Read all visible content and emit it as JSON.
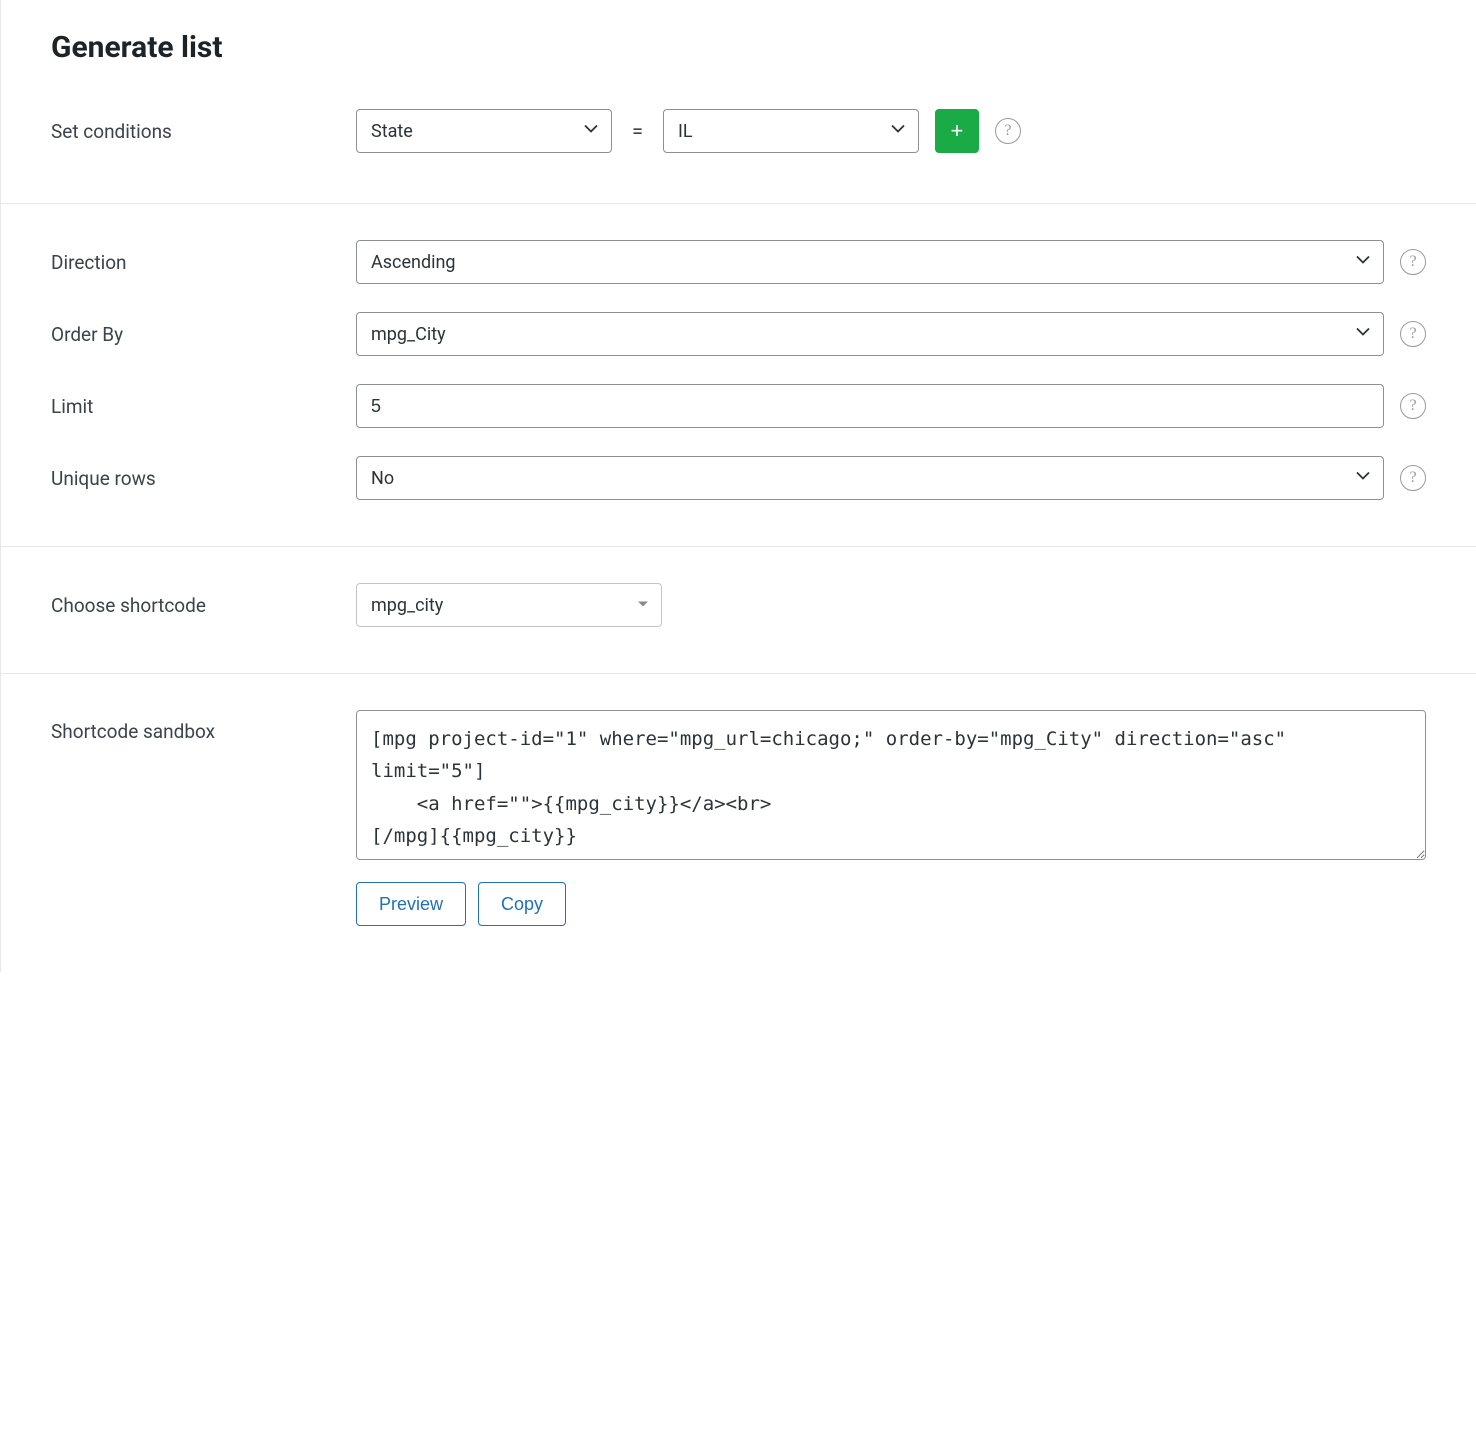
{
  "title": "Generate list",
  "conditions": {
    "label": "Set conditions",
    "field_value": "State",
    "operator": "=",
    "value": "IL",
    "add_label": "+",
    "help": "?"
  },
  "direction": {
    "label": "Direction",
    "value": "Ascending",
    "help": "?"
  },
  "order_by": {
    "label": "Order By",
    "value": "mpg_City",
    "help": "?"
  },
  "limit": {
    "label": "Limit",
    "value": "5",
    "help": "?"
  },
  "unique_rows": {
    "label": "Unique rows",
    "value": "No",
    "help": "?"
  },
  "shortcode": {
    "label": "Choose shortcode",
    "value": "mpg_city"
  },
  "sandbox": {
    "label": "Shortcode sandbox",
    "code": "[mpg project-id=\"1\" where=\"mpg_url=chicago;\" order-by=\"mpg_City\" direction=\"asc\" limit=\"5\"]\n    <a href=\"\">{{mpg_city}}</a><br>\n[/mpg]{{mpg_city}}",
    "preview": "Preview",
    "copy": "Copy"
  }
}
